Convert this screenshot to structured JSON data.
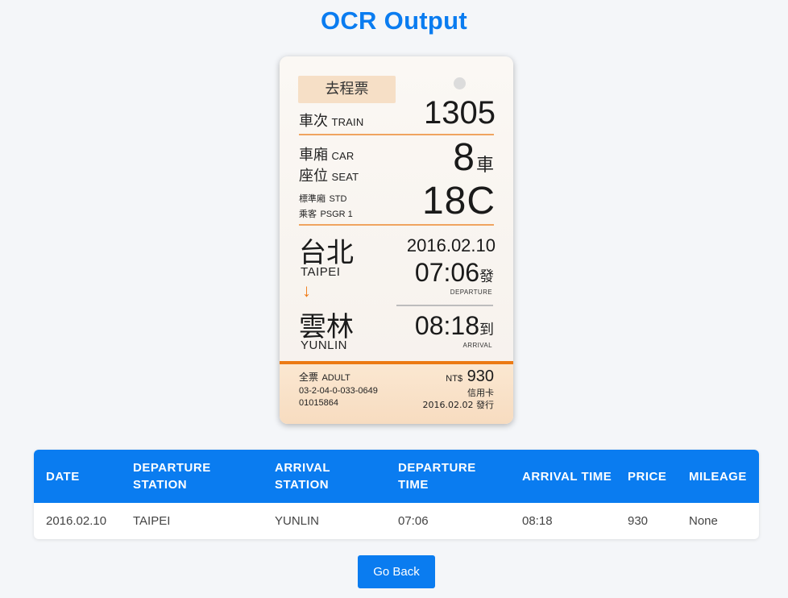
{
  "page": {
    "title": "OCR Output"
  },
  "ticket": {
    "trip_type": "去程票",
    "train_label_zh": "車次",
    "train_label_en": "TRAIN",
    "train_number": "1305",
    "car_label_zh": "車廂",
    "car_label_en": "CAR",
    "car_number": "8",
    "car_unit": "車",
    "seat_label_zh": "座位",
    "seat_label_en": "SEAT",
    "class_label_zh": "標準廂",
    "class_label_en": "STD",
    "passenger_label_zh": "乘客",
    "passenger_label_en": "PSGR 1",
    "seat_number": "18C",
    "from_city_zh": "台北",
    "from_city_en": "TAIPEI",
    "direction_arrow": "↓",
    "to_city_zh": "雲林",
    "to_city_en": "YUNLIN",
    "travel_date": "2016.02.10",
    "departure_time": "07:06",
    "departure_suffix": "發",
    "departure_caption": "DEPARTURE",
    "arrival_time": "08:18",
    "arrival_suffix": "到",
    "arrival_caption": "ARRIVAL",
    "fare_type_zh": "全票",
    "fare_type_en": "ADULT",
    "currency": "NT$",
    "price": "930",
    "ticket_code": "03-2-04-0-033-0649",
    "payment": "信用卡",
    "serial": "01015864",
    "issue_date": "2016.02.02 發行"
  },
  "table": {
    "headers": [
      "DATE",
      "DEPARTURE STATION",
      "ARRIVAL STATION",
      "DEPARTURE TIME",
      "ARRIVAL TIME",
      "PRICE",
      "MILEAGE"
    ],
    "rows": [
      [
        "2016.02.10",
        "TAIPEI",
        "YUNLIN",
        "07:06",
        "08:18",
        "930",
        "None"
      ]
    ]
  },
  "actions": {
    "go_back_label": "Go Back"
  },
  "colors": {
    "accent": "#0a7cf0",
    "ticket_orange": "#ec7a14",
    "page_bg": "#f4f6f9"
  }
}
